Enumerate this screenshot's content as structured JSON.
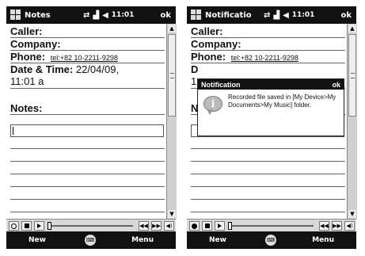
{
  "left": {
    "title": "Notes",
    "clock": "11:01",
    "ok": "ok",
    "fields": {
      "caller_label": "Caller",
      "company_label": "Company",
      "phone_label": "Phone",
      "phone_value": "tel:+82 10-2211-9298",
      "datetime_label": "Date & Time",
      "datetime_value_1": "22/04/09,",
      "datetime_value_2": "11:01 a",
      "notes_label": "Notes"
    },
    "softkeys": {
      "left": "New",
      "right": "Menu"
    }
  },
  "right": {
    "title": "Notificatio",
    "clock": "11:01",
    "ok": "ok",
    "fields": {
      "caller_label": "Caller",
      "company_label": "Company",
      "phone_label": "Phone",
      "phone_value": "tel:+82 10-2211-9298",
      "datetime_partial": "D",
      "second_line_partial": "1",
      "notes_partial": "N"
    },
    "popup": {
      "title": "Notification",
      "ok": "ok",
      "message": "Recorded file saved in [My Device>My Documents>My Music] folder."
    },
    "softkeys": {
      "left": "New",
      "right": "Menu"
    }
  },
  "icons": {
    "start": "windows-flag-icon",
    "status": [
      "sync-arrows-icon",
      "signal-icon",
      "volume-icon"
    ],
    "info": "info-bubble-icon"
  }
}
